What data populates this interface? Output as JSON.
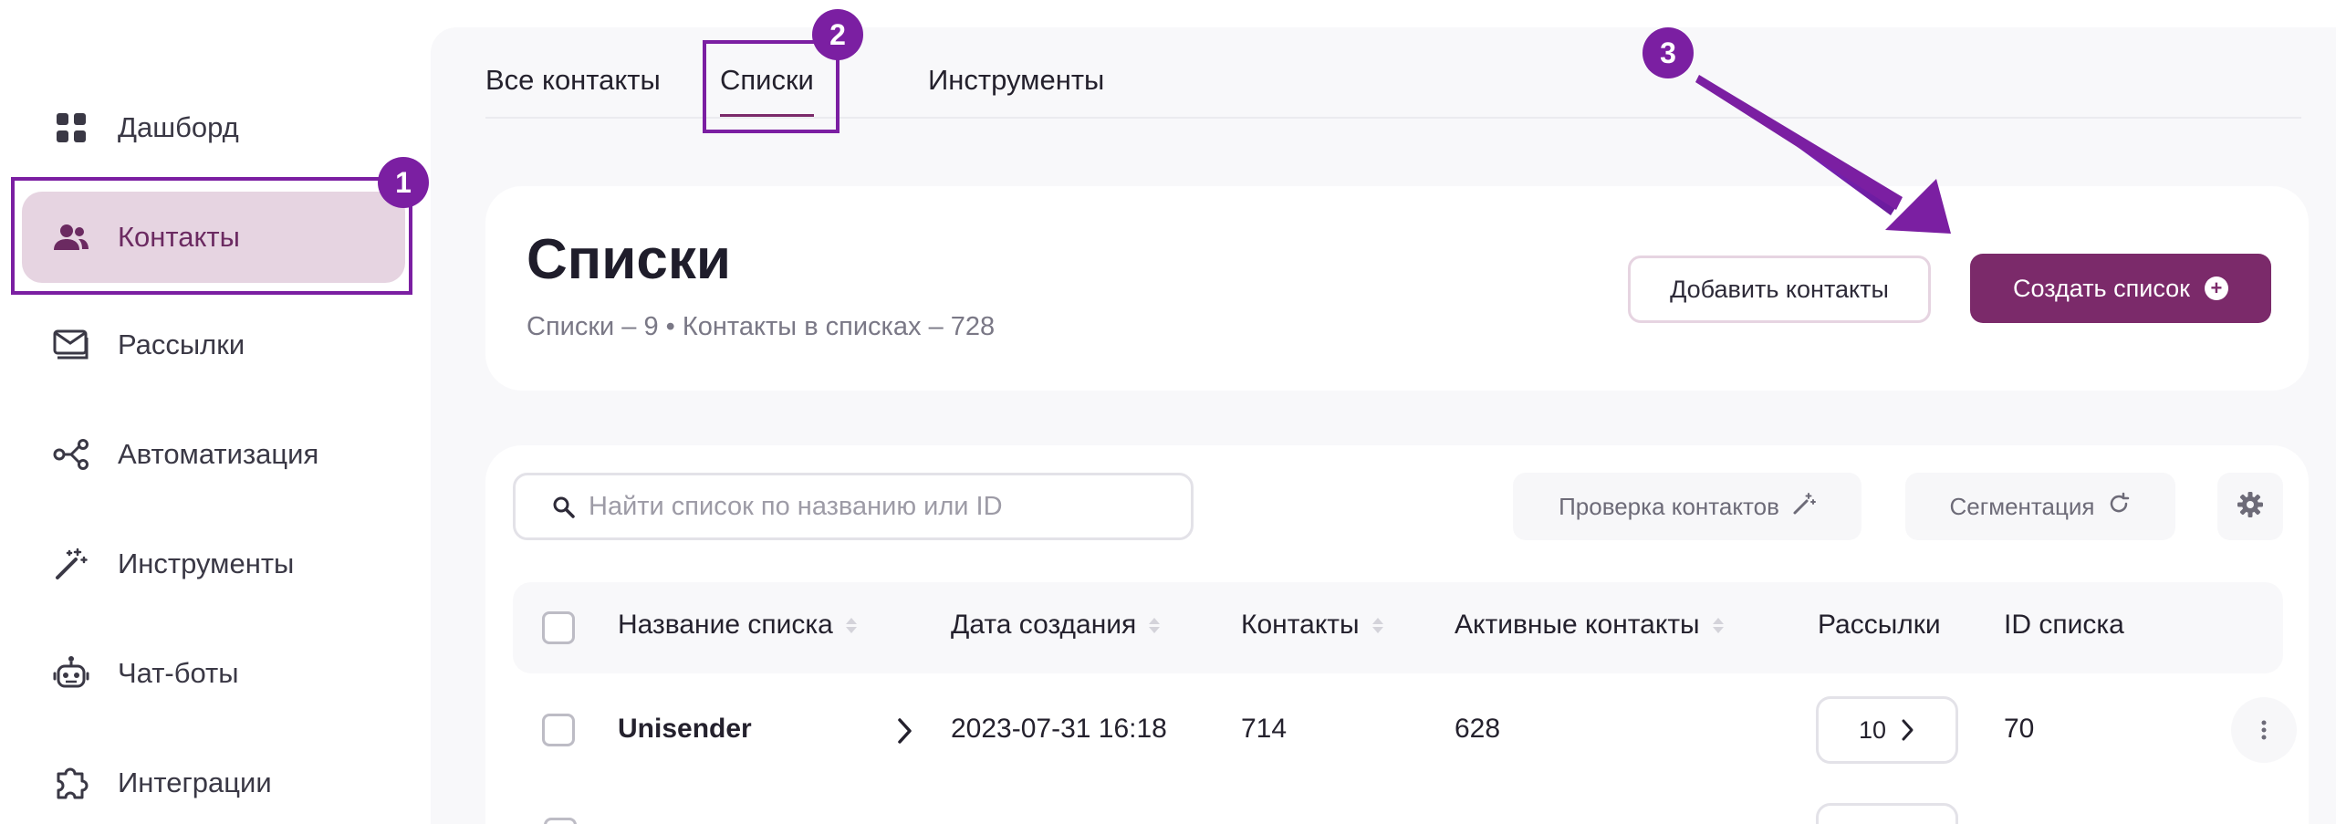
{
  "sidebar": {
    "items": [
      {
        "label": "Дашборд",
        "icon": "grid-icon"
      },
      {
        "label": "Контакты",
        "icon": "users-icon",
        "active": true
      },
      {
        "label": "Рассылки",
        "icon": "mail-stack-icon"
      },
      {
        "label": "Автоматизация",
        "icon": "share-nodes-icon"
      },
      {
        "label": "Инструменты",
        "icon": "magic-wand-icon"
      },
      {
        "label": "Чат-боты",
        "icon": "robot-icon"
      },
      {
        "label": "Интеграции",
        "icon": "puzzle-icon"
      }
    ]
  },
  "badges": {
    "one": "1",
    "two": "2",
    "three": "3"
  },
  "tabs": [
    {
      "label": "Все контакты"
    },
    {
      "label": "Списки",
      "active": true
    },
    {
      "label": "Инструменты"
    }
  ],
  "header": {
    "title": "Списки",
    "subtitle": "Списки – 9 • Контакты в списках – 728",
    "add_contacts_label": "Добавить контакты",
    "create_list_label": "Создать список"
  },
  "search": {
    "placeholder": "Найти список по названию или ID"
  },
  "tools": {
    "check_contacts_label": "Проверка контактов",
    "segmentation_label": "Сегментация"
  },
  "table": {
    "columns": [
      "Название списка",
      "Дата создания",
      "Контакты",
      "Активные контакты",
      "Рассылки",
      "ID списка"
    ],
    "rows": [
      {
        "name": "Unisender",
        "created": "2023-07-31 16:18",
        "contacts": "714",
        "active": "628",
        "mailings": "10",
        "id": "70"
      }
    ]
  },
  "colors": {
    "accent": "#7b2a6a",
    "annotation": "#7b1fa2",
    "active_bg": "#e6d4e1"
  }
}
